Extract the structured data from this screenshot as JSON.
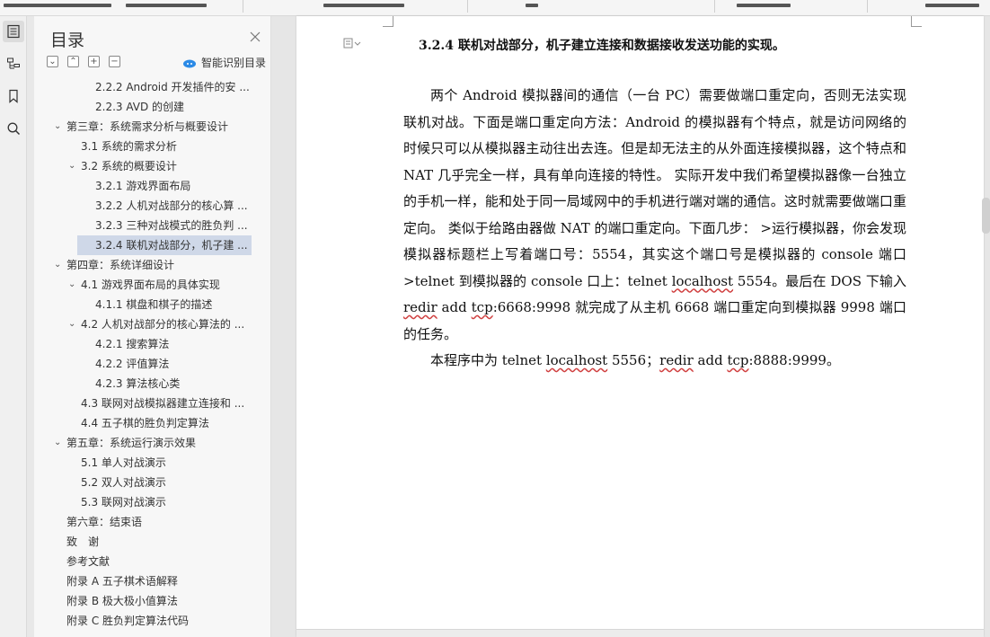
{
  "toc": {
    "title": "目录",
    "smart_label": "智能识别目录",
    "items": [
      {
        "text": "2.2.2 Android 开发插件的安 ...",
        "level": 3,
        "arrow": ""
      },
      {
        "text": "2.2.3 AVD 的创建",
        "level": 3,
        "arrow": ""
      },
      {
        "text": "第三章：系统需求分析与概要设计",
        "level": 1,
        "arrow": "⌄"
      },
      {
        "text": "3.1 系统的需求分析",
        "level": 2,
        "arrow": ""
      },
      {
        "text": "3.2 系统的概要设计",
        "level": 2,
        "arrow": "⌄"
      },
      {
        "text": "3.2.1 游戏界面布局",
        "level": 3,
        "arrow": ""
      },
      {
        "text": "3.2.2 人机对战部分的核心算 ...",
        "level": 3,
        "arrow": ""
      },
      {
        "text": "3.2.3 三种对战模式的胜负判 ...",
        "level": 3,
        "arrow": ""
      },
      {
        "text": "3.2.4 联机对战部分，机子建 ...",
        "level": 3,
        "arrow": "",
        "selected": true
      },
      {
        "text": "第四章：系统详细设计",
        "level": 1,
        "arrow": "⌄"
      },
      {
        "text": "4.1 游戏界面布局的具体实现",
        "level": 2,
        "arrow": "⌄"
      },
      {
        "text": "4.1.1 棋盘和棋子的描述",
        "level": 3,
        "arrow": ""
      },
      {
        "text": "4.2 人机对战部分的核心算法的 ...",
        "level": 2,
        "arrow": "⌄"
      },
      {
        "text": "4.2.1  搜索算法",
        "level": 3,
        "arrow": ""
      },
      {
        "text": "4.2.2  评值算法",
        "level": 3,
        "arrow": ""
      },
      {
        "text": "4.2.3  算法核心类",
        "level": 3,
        "arrow": ""
      },
      {
        "text": "4.3 联网对战模拟器建立连接和 ...",
        "level": 2,
        "arrow": ""
      },
      {
        "text": "4.4 五子棋的胜负判定算法",
        "level": 2,
        "arrow": ""
      },
      {
        "text": "第五章：系统运行演示效果",
        "level": 1,
        "arrow": "⌄"
      },
      {
        "text": "5.1 单人对战演示",
        "level": 2,
        "arrow": ""
      },
      {
        "text": "5.2 双人对战演示",
        "level": 2,
        "arrow": ""
      },
      {
        "text": "5.3 联网对战演示",
        "level": 2,
        "arrow": ""
      },
      {
        "text": "第六章：结束语",
        "level": 1,
        "arrow": ""
      },
      {
        "text": "致　谢",
        "level": 1,
        "arrow": ""
      },
      {
        "text": "参考文献",
        "level": 1,
        "arrow": ""
      },
      {
        "text": "附录 A 五子棋术语解释",
        "level": 1,
        "arrow": ""
      },
      {
        "text": "附录 B 极大极小值算法",
        "level": 1,
        "arrow": ""
      },
      {
        "text": "附录 C 胜负判定算法代码",
        "level": 1,
        "arrow": ""
      }
    ]
  },
  "doc": {
    "heading": "3.2.4  联机对战部分，机子建立连接和数据接收发送功能的实现。",
    "p1_a": "两个 Android 模拟器间的通信（一台 PC）需要做端口重定向，否则无法实现联机对战。下面是端口重定向方法：Android 的模拟器有个特点，就是访问网络的时候只可以从模拟器主动往出去连。但是却无法主的从外面连接模拟器，这个特点和 NAT 几乎完全一样，具有单向连接的特性。 实际开发中我们希望模拟器像一台独立的手机一样，能和处于同一局域网中的手机进行端对端的通信。这时就需要做端口重定向。 类似于给路由器做 NAT 的端口重定向。下面几步： >运行模拟器，你会发现模拟器标题栏上写着端口号：5554，其实这个端口号是模拟器的 console 端口 >telnet 到模拟器的 console 口上：telnet ",
    "p1_b": "localhost",
    "p1_c": " 5554。最后在 DOS 下输入 ",
    "p1_d": "redir",
    "p1_e": " add ",
    "p1_f": "tcp",
    "p1_g": ":6668:9998 就完成了从主机 6668 端口重定向到模拟器 9998 端口的任务。",
    "p2_a": "本程序中为 telnet ",
    "p2_b": "localhost",
    "p2_c": " 5556；",
    "p2_d": "redir",
    "p2_e": " add ",
    "p2_f": "tcp",
    "p2_g": ":8888:9999。"
  },
  "icons": [
    "toc-icon",
    "outline-icon",
    "bookmark-icon",
    "search-icon",
    "close-icon",
    "collapse-icon",
    "expand-icon",
    "add-icon",
    "remove-icon",
    "cloud-icon",
    "paragraph-icon"
  ]
}
